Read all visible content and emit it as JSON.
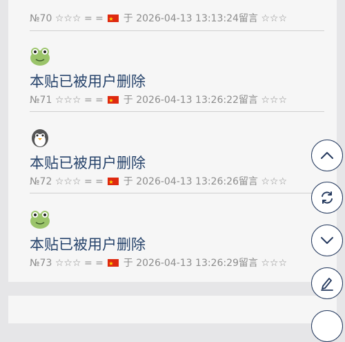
{
  "posts": [
    {
      "number": "№70",
      "stars_left": "☆☆☆",
      "equals": "= =",
      "flag": "🇨🇳",
      "yu": "于",
      "datetime": "2026-04-13 13:13:24",
      "reply_label": "留言",
      "stars_right": "☆☆☆"
    },
    {
      "avatar": "frog-avatar",
      "title": "本贴已被用户删除",
      "number": "№71",
      "stars_left": "☆☆☆",
      "equals": "= =",
      "flag": "🇨🇳",
      "yu": "于",
      "datetime": "2026-04-13 13:26:22",
      "reply_label": "留言",
      "stars_right": "☆☆☆"
    },
    {
      "avatar": "penguin-avatar",
      "title": "本贴已被用户删除",
      "number": "№72",
      "stars_left": "☆☆☆",
      "equals": "= =",
      "flag": "🇨🇳",
      "yu": "于",
      "datetime": "2026-04-13 13:26:26",
      "reply_label": "留言",
      "stars_right": "☆☆☆"
    },
    {
      "avatar": "frog-avatar",
      "title": "本贴已被用户删除",
      "number": "№73",
      "stars_left": "☆☆☆",
      "equals": "= =",
      "flag": "🇨🇳",
      "yu": "于",
      "datetime": "2026-04-13 13:26:29",
      "reply_label": "留言",
      "stars_right": "☆☆☆"
    }
  ],
  "floating_buttons": [
    "chevron-up-icon",
    "refresh-icon",
    "chevron-down-icon",
    "edit-pen-icon"
  ],
  "colors": {
    "page_bg": "#e6e6e8",
    "card_bg": "#f6f6f6",
    "title": "#26436b",
    "meta": "#8c8c8c",
    "button_border": "#24395e"
  }
}
